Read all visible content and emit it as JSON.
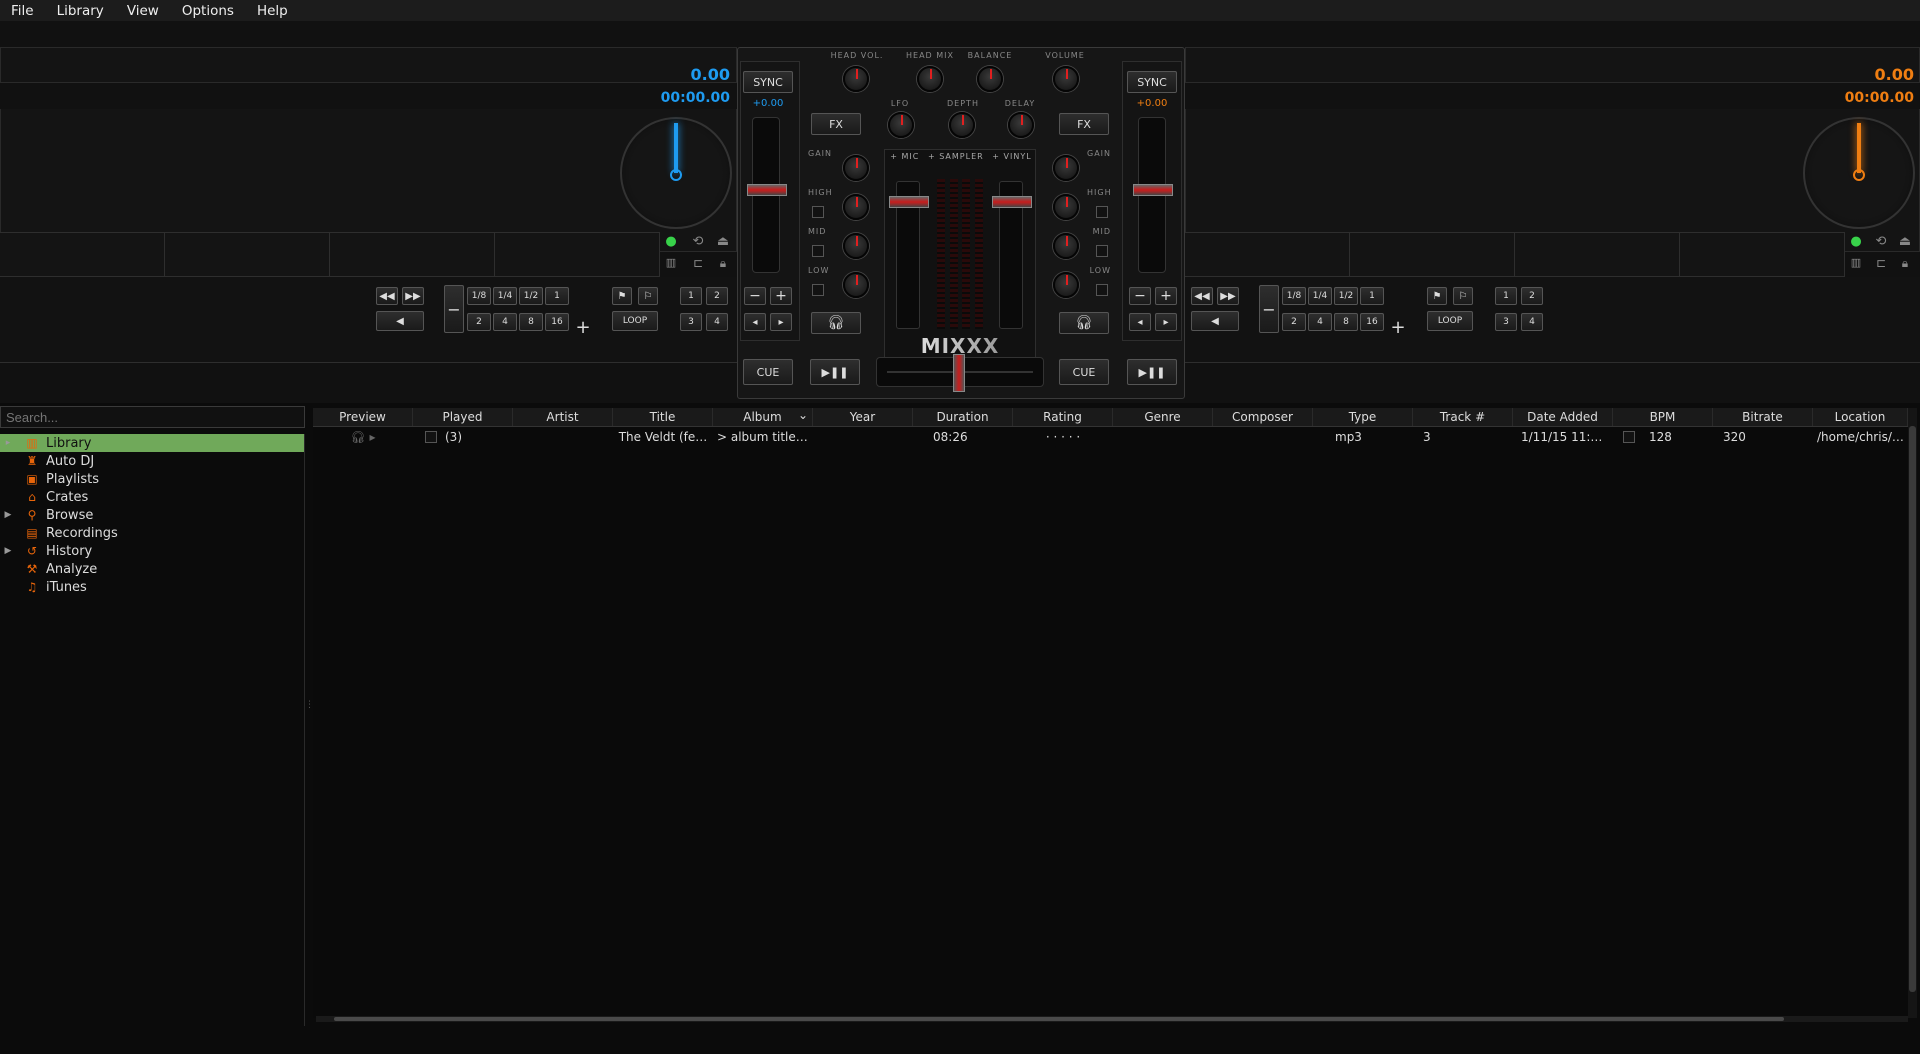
{
  "menu": [
    "File",
    "Library",
    "View",
    "Options",
    "Help"
  ],
  "colors": {
    "left_accent": "#1e9bf0",
    "right_accent": "#ef7e12",
    "selected": "#70a95a",
    "icon": "#e8650a"
  },
  "deck_left": {
    "rate": "0.00",
    "time": "00:00.00",
    "pitch": "+0.00",
    "sync": "SYNC",
    "fx": "FX",
    "cue": "CUE",
    "play": "▶❚❚",
    "loop": "LOOP",
    "beatloop_top": [
      "1/8",
      "1/4",
      "1/2",
      "1"
    ],
    "beatloop_bottom": [
      "2",
      "4",
      "8",
      "16"
    ],
    "hotcue_top": [
      "1",
      "2"
    ],
    "hotcue_bottom": [
      "3",
      "4"
    ]
  },
  "deck_right": {
    "rate": "0.00",
    "time": "00:00.00",
    "pitch": "+0.00",
    "sync": "SYNC",
    "fx": "FX",
    "cue": "CUE",
    "play": "▶❚❚",
    "loop": "LOOP",
    "beatloop_top": [
      "1/8",
      "1/4",
      "1/2",
      "1"
    ],
    "beatloop_bottom": [
      "2",
      "4",
      "8",
      "16"
    ],
    "hotcue_top": [
      "1",
      "2"
    ],
    "hotcue_bottom": [
      "3",
      "4"
    ]
  },
  "mixer": {
    "head_vol": "HEAD VOL.",
    "head_mix": "HEAD MIX",
    "balance": "BALANCE",
    "volume": "VOLUME",
    "lfo": "LFO",
    "depth": "DEPTH",
    "delay": "DELAY",
    "gain": "GAIN",
    "high": "HIGH",
    "mid": "MID",
    "low": "LOW",
    "mic": "+ MIC",
    "sampler": "+ SAMPLER",
    "vinyl": "+ VINYL",
    "logo": "MIXXX"
  },
  "search": {
    "placeholder": "Search..."
  },
  "sidebar": [
    {
      "label": "Library",
      "icon": "library-icon",
      "glyph": "▥",
      "expand": "▸",
      "selected": true
    },
    {
      "label": "Auto DJ",
      "icon": "autodj-icon",
      "glyph": "♜",
      "expand": ""
    },
    {
      "label": "Playlists",
      "icon": "playlists-icon",
      "glyph": "▣",
      "expand": ""
    },
    {
      "label": "Crates",
      "icon": "crates-icon",
      "glyph": "⌂",
      "expand": ""
    },
    {
      "label": "Browse",
      "icon": "browse-icon",
      "glyph": "⚲",
      "expand": "▶"
    },
    {
      "label": "Recordings",
      "icon": "recordings-icon",
      "glyph": "▤",
      "expand": ""
    },
    {
      "label": "History",
      "icon": "history-icon",
      "glyph": "↺",
      "expand": "▶"
    },
    {
      "label": "Analyze",
      "icon": "analyze-icon",
      "glyph": "⚒",
      "expand": ""
    },
    {
      "label": "iTunes",
      "icon": "itunes-icon",
      "glyph": "♫",
      "expand": ""
    }
  ],
  "columns": [
    "Preview",
    "Played",
    "Artist",
    "Title",
    "Album",
    "Year",
    "Duration",
    "Rating",
    "Genre",
    "Composer",
    "Type",
    "Track #",
    "Date Added",
    "BPM",
    "Bitrate",
    "Location"
  ],
  "sort_indicator": "⌄",
  "tracks": [
    {
      "played": "(3)",
      "artist": "",
      "title": "The Veldt (fe…",
      "album": "> album title …",
      "year": "",
      "duration": "08:26",
      "rating": "· · · · ·",
      "genre": "",
      "composer": "",
      "type": "mp3",
      "track": "3",
      "date_added": "1/11/15 11:2…",
      "bpm": "128",
      "bitrate": "320",
      "location": "/home/chris/…"
    }
  ]
}
